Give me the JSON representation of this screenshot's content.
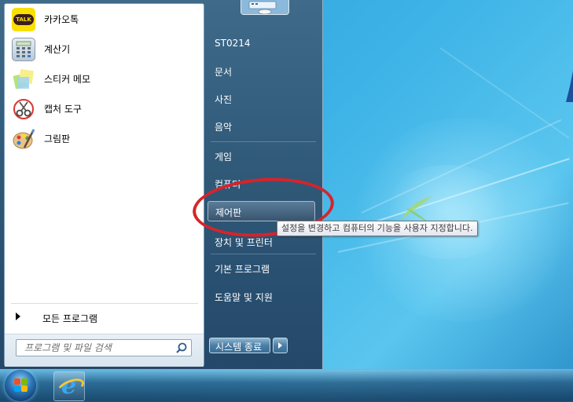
{
  "start_menu": {
    "pinned_programs": [
      {
        "label": "카카오톡",
        "icon": "kakaotalk-icon",
        "icon_text": "TALK"
      },
      {
        "label": "계산기",
        "icon": "calculator-icon"
      },
      {
        "label": "스티커 메모",
        "icon": "sticky-notes-icon"
      },
      {
        "label": "캡처 도구",
        "icon": "snipping-tool-icon"
      },
      {
        "label": "그림판",
        "icon": "paint-icon"
      }
    ],
    "all_programs_label": "모든 프로그램",
    "search": {
      "placeholder": "프로그램 및 파일 검색",
      "value": ""
    },
    "right_items": [
      {
        "label": "ST0214"
      },
      {
        "label": "문서"
      },
      {
        "label": "사진"
      },
      {
        "label": "음악"
      },
      {
        "label": "게임"
      },
      {
        "label": "컴퓨터"
      },
      {
        "label": "제어판"
      },
      {
        "label": "장치 및 프린터"
      },
      {
        "label": "기본 프로그램"
      },
      {
        "label": "도움말 및 지원"
      }
    ],
    "shutdown_label": "시스템 종료"
  },
  "tooltip": {
    "text": "설정을 변경하고 컴퓨터의 기능을 사용자 지정합니다."
  },
  "taskbar": {
    "start_button": "windows-start-orb-icon",
    "pinned": [
      {
        "icon": "internet-explorer-icon",
        "glyph": "e"
      }
    ]
  },
  "colors": {
    "desktop": "#3cb2e6",
    "menu_frame": "#2f5877",
    "annotation": "#d8232a",
    "kakaotalk": "#f9e000"
  }
}
